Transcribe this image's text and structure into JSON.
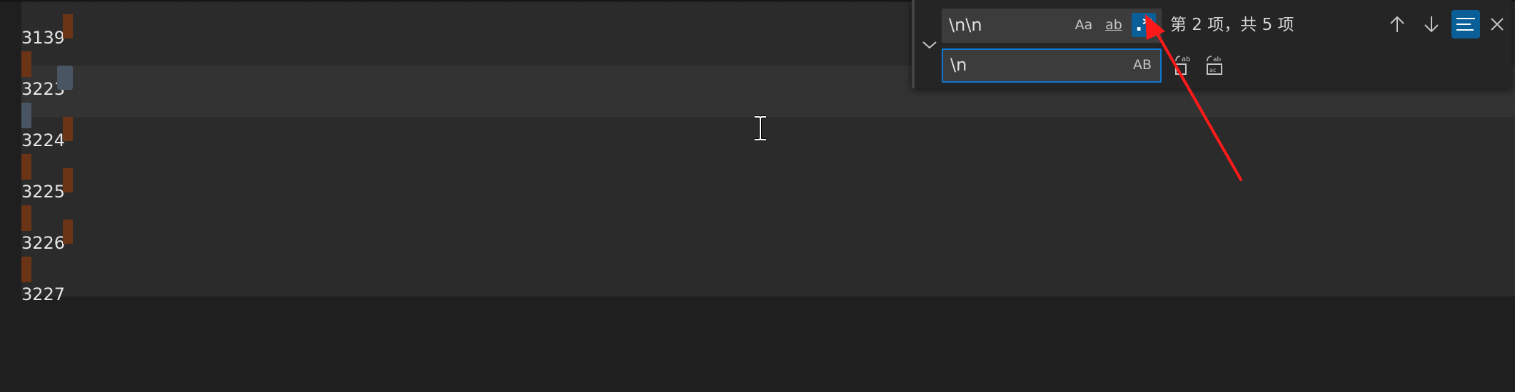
{
  "editor": {
    "lines": [
      {
        "number": "3139",
        "state": "match"
      },
      {
        "number": "3223",
        "state": "current"
      },
      {
        "number": "3224",
        "state": "match"
      },
      {
        "number": "3225",
        "state": "match"
      },
      {
        "number": "3226",
        "state": "match"
      },
      {
        "number": "3227",
        "state": "plain"
      }
    ]
  },
  "find_widget": {
    "find_value": "\\n\\n",
    "replace_value": "\\n",
    "match_case_label": "Aa",
    "whole_word_label": "ab",
    "regex_label": ".*",
    "preserve_case_label": "AB",
    "match_status": "第 2 项，共 5 项",
    "regex_enabled": true,
    "find_in_selection_enabled": true
  },
  "colors": {
    "accent": "#0b5f98",
    "match_highlight": "#6b3416",
    "annotation_arrow": "#ff1a1a"
  }
}
